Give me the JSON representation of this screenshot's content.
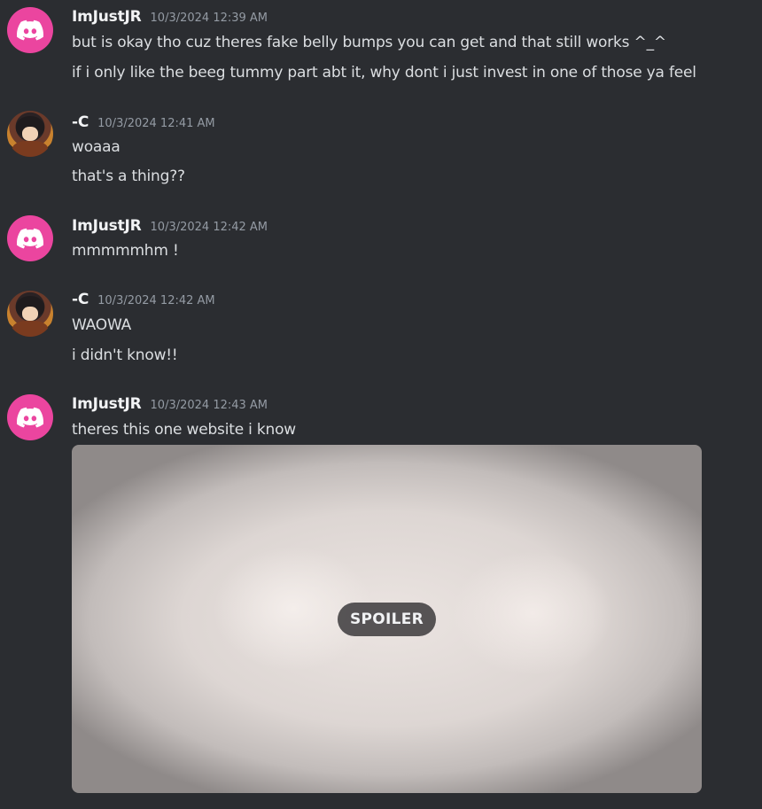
{
  "messages": [
    {
      "author": "ImJustJR",
      "avatar": "discord-logo-icon",
      "timestamp": "10/3/2024 12:39 AM",
      "lines": [
        "but is okay tho cuz theres fake belly bumps you can get and that still works ^_^",
        "if i only like the beeg tummy part abt it, why dont i just invest in one of those ya feel"
      ]
    },
    {
      "author": "-C",
      "avatar": "anime-avatar-icon",
      "timestamp": "10/3/2024 12:41 AM",
      "lines": [
        "woaaa",
        "that's a thing??"
      ]
    },
    {
      "author": "ImJustJR",
      "avatar": "discord-logo-icon",
      "timestamp": "10/3/2024 12:42 AM",
      "lines": [
        "mmmmmhm !"
      ]
    },
    {
      "author": "-C",
      "avatar": "anime-avatar-icon",
      "timestamp": "10/3/2024 12:42 AM",
      "lines": [
        "WAOWA",
        "i didn't know!!"
      ]
    },
    {
      "author": "ImJustJR",
      "avatar": "discord-logo-icon",
      "timestamp": "10/3/2024 12:43 AM",
      "lines": [
        "theres this one website i know"
      ],
      "attachment": {
        "type": "spoiler-image",
        "label": "SPOILER"
      }
    }
  ],
  "colors": {
    "background": "#2b2d31",
    "discord_avatar": "#eb459f",
    "username": "#f2f3f5",
    "timestamp": "#949ba4",
    "text": "#dbdee1"
  }
}
